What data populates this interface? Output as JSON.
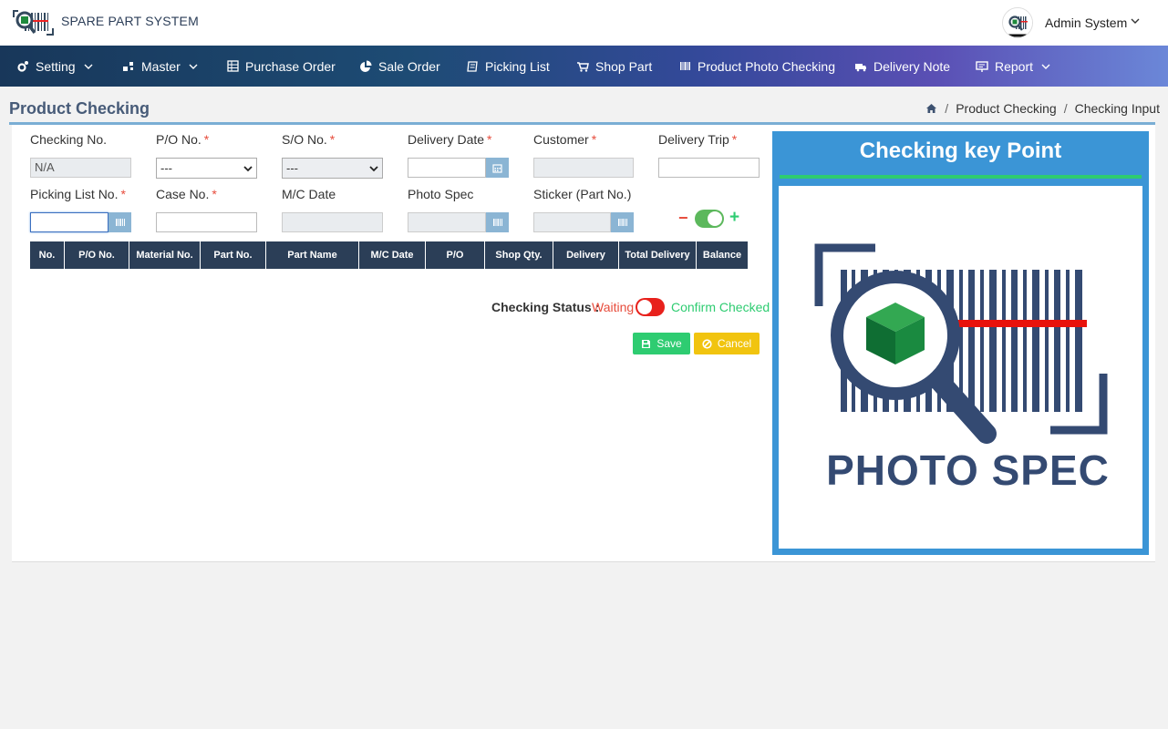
{
  "app": {
    "title": "SPARE PART SYSTEM",
    "user": "Admin System"
  },
  "nav": [
    {
      "label": "Setting",
      "icon": "gear-icon",
      "dropdown": true
    },
    {
      "label": "Master",
      "icon": "network-icon",
      "dropdown": true
    },
    {
      "label": "Purchase Order",
      "icon": "table-icon",
      "dropdown": false
    },
    {
      "label": "Sale Order",
      "icon": "pie-chart-icon",
      "dropdown": false
    },
    {
      "label": "Picking List",
      "icon": "list-icon",
      "dropdown": false
    },
    {
      "label": "Shop Part",
      "icon": "cart-icon",
      "dropdown": false
    },
    {
      "label": "Product Photo Checking",
      "icon": "barcode-icon",
      "dropdown": false
    },
    {
      "label": "Delivery Note",
      "icon": "truck-icon",
      "dropdown": false
    },
    {
      "label": "Report",
      "icon": "report-icon",
      "dropdown": true
    }
  ],
  "page": {
    "title": "Product Checking",
    "breadcrumb": [
      "Product Checking",
      "Checking Input"
    ]
  },
  "form": {
    "checking_no": {
      "label": "Checking No.",
      "value": "N/A"
    },
    "po_no": {
      "label": "P/O No.",
      "value": "---"
    },
    "so_no": {
      "label": "S/O No.",
      "value": "---"
    },
    "delivery_date": {
      "label": "Delivery Date",
      "value": ""
    },
    "customer": {
      "label": "Customer",
      "value": ""
    },
    "delivery_trip": {
      "label": "Delivery Trip",
      "value": ""
    },
    "picking_list_no": {
      "label": "Picking List No.",
      "value": ""
    },
    "case_no": {
      "label": "Case No.",
      "value": ""
    },
    "mc_date": {
      "label": "M/C Date",
      "value": ""
    },
    "photo_spec": {
      "label": "Photo Spec",
      "value": ""
    },
    "sticker": {
      "label": "Sticker (Part No.)",
      "value": ""
    },
    "minus": "−",
    "plus": "+",
    "req": "*"
  },
  "table": {
    "columns": [
      "No.",
      "P/O No.",
      "Material No.",
      "Part No.",
      "Part Name",
      "M/C Date",
      "P/O",
      "Shop Qty.",
      "Delivery",
      "Total Delivery",
      "Balance"
    ],
    "rows": []
  },
  "status": {
    "label": "Checking Status :",
    "waiting": "Waiting",
    "confirmed": "Confirm Checked"
  },
  "buttons": {
    "save": "Save",
    "cancel": "Cancel"
  },
  "keypoint": {
    "title": "Checking key Point",
    "image_text": "PHOTO SPEC"
  },
  "colors": {
    "navy": "#2b3e57",
    "accent_blue": "#3b95d6",
    "green": "#2ecc71",
    "red": "#e74c3c",
    "yellow": "#f1c40f"
  }
}
